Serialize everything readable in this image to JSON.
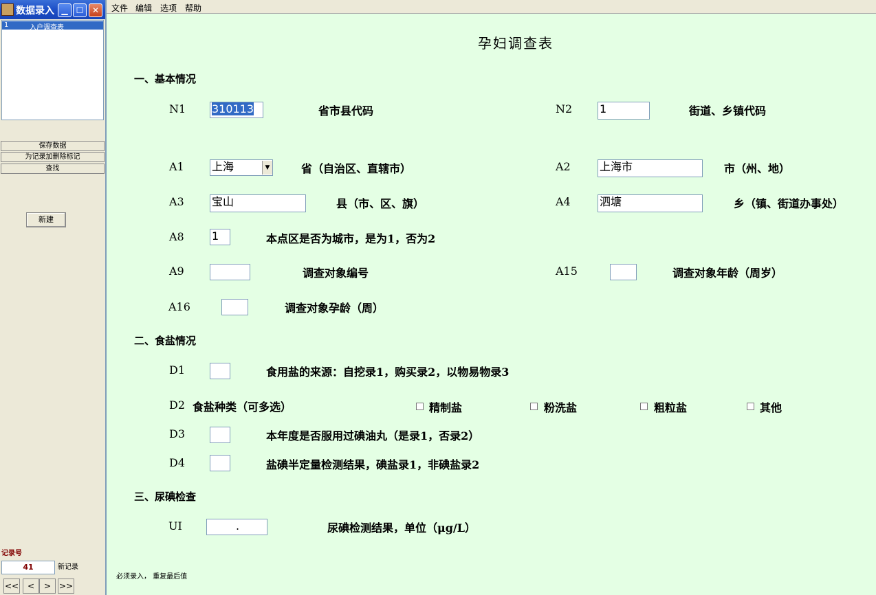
{
  "window": {
    "title": "数据录入"
  },
  "sidebar": {
    "forms": [
      {
        "num": "1",
        "name": "入户调查表"
      }
    ],
    "buttons": {
      "save": "保存数据",
      "mark_delete": "为记录加删除标记",
      "find": "查找",
      "new": "新建"
    },
    "record": {
      "label": "记录号",
      "value": "41",
      "status": "新记录"
    },
    "nav": {
      "first": "<<",
      "prev": "<",
      "next": ">",
      "last": ">>"
    }
  },
  "menu": {
    "file": "文件",
    "edit": "编辑",
    "options": "选项",
    "help": "帮助"
  },
  "form": {
    "title": "孕妇调查表",
    "sections": {
      "basic": "一、基本情况",
      "salt": "二、食盐情况",
      "urine": "三、尿碘检查"
    },
    "fields": {
      "n1": {
        "code": "N1",
        "value": "310113",
        "label": "省市县代码"
      },
      "n2": {
        "code": "N2",
        "value": "1",
        "label": "街道、乡镇代码"
      },
      "a1": {
        "code": "A1",
        "value": "上海",
        "label": "省（自治区、直辖市）"
      },
      "a2": {
        "code": "A2",
        "value": "上海市",
        "label": "市（州、地）"
      },
      "a3": {
        "code": "A3",
        "value": "宝山",
        "label": "县（市、区、旗）"
      },
      "a4": {
        "code": "A4",
        "value": "泗塘",
        "label": "乡（镇、街道办事处）"
      },
      "a8": {
        "code": "A8",
        "value": "1",
        "label": "本点区是否为城市，是为1，否为2"
      },
      "a9": {
        "code": "A9",
        "value": "",
        "label": "调查对象编号"
      },
      "a15": {
        "code": "A15",
        "value": "",
        "label": "调查对象年龄（周岁）"
      },
      "a16": {
        "code": "A16",
        "value": "",
        "label": "调查对象孕龄（周）"
      },
      "d1": {
        "code": "D1",
        "value": "",
        "label": "食用盐的来源：自挖录1，购买录2，以物易物录3"
      },
      "d2": {
        "code": "D2",
        "label": "食盐种类（可多选）",
        "options": [
          "精制盐",
          "粉洗盐",
          "粗粒盐",
          "其他"
        ]
      },
      "d3": {
        "code": "D3",
        "value": "",
        "label": "本年度是否服用过碘油丸（是录1，否录2）"
      },
      "d4": {
        "code": "D4",
        "value": "",
        "label": "盐碘半定量检测结果，碘盐录1，非碘盐录2"
      },
      "ui": {
        "code": "UI",
        "value": ".",
        "label": "尿碘检测结果，单位（μg/L）"
      }
    },
    "footnote": "必须录入， 重复最后值"
  }
}
